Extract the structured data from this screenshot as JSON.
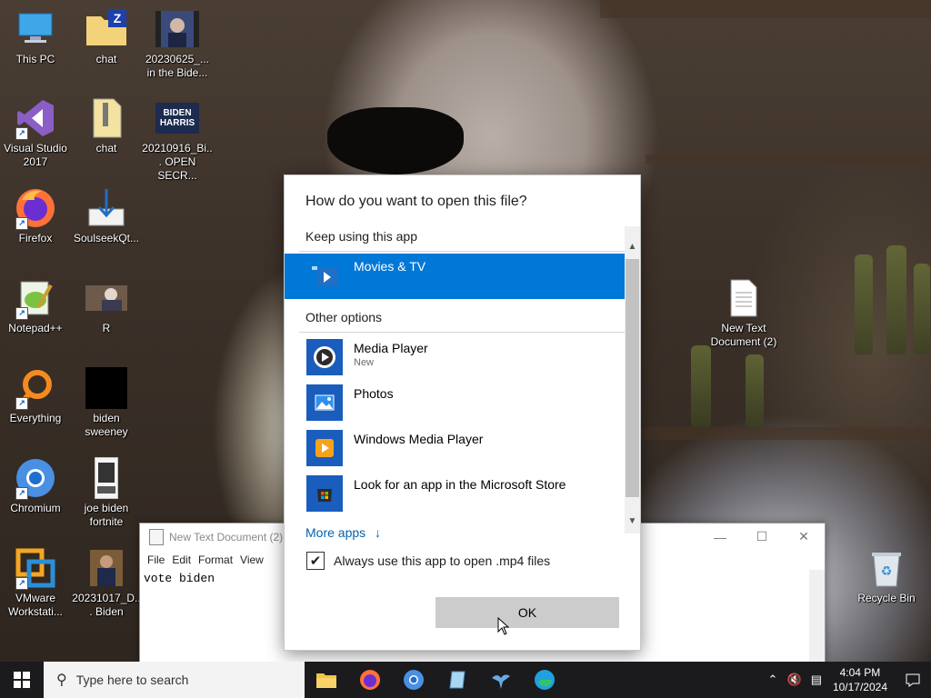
{
  "desktop": {
    "icons": [
      {
        "label": "This PC"
      },
      {
        "label": "chat"
      },
      {
        "label": "20230625_... in the Bide..."
      },
      {
        "label": "Visual Studio 2017"
      },
      {
        "label": "chat"
      },
      {
        "label": "20210916_Bi... OPEN SECR..."
      },
      {
        "label": "Firefox"
      },
      {
        "label": "SoulseekQt..."
      },
      {
        "label": "Notepad++"
      },
      {
        "label": "R"
      },
      {
        "label": "Everything"
      },
      {
        "label": "biden sweeney"
      },
      {
        "label": "Chromium"
      },
      {
        "label": "joe biden fortnite"
      },
      {
        "label": "VMware Workstati..."
      },
      {
        "label": "20231017_D... Biden"
      },
      {
        "label": "New Text Document (2)"
      },
      {
        "label": "Recycle Bin"
      }
    ],
    "thumb_text": {
      "biden_harris_line1": "BIDEN",
      "biden_harris_line2": "HARRIS"
    }
  },
  "notepad": {
    "title": "New Text Document (2) -",
    "menu": [
      "File",
      "Edit",
      "Format",
      "View"
    ],
    "content": "vote biden"
  },
  "dialog": {
    "title": "How do you want to open this file?",
    "keep_using_header": "Keep using this app",
    "current_app": {
      "name": "Movies & TV"
    },
    "other_header": "Other options",
    "apps": [
      {
        "name": "Media Player",
        "sub": "New"
      },
      {
        "name": "Photos"
      },
      {
        "name": "Windows Media Player"
      },
      {
        "name": "Look for an app in the Microsoft Store"
      }
    ],
    "more_apps": "More apps",
    "more_apps_arrow": "↓",
    "always_use": "Always use this app to open .mp4 files",
    "always_checked": true,
    "ok": "OK"
  },
  "taskbar": {
    "search_placeholder": "Type here to search",
    "time": "4:04 PM",
    "date": "10/17/2024"
  },
  "colors": {
    "accent": "#0078d7",
    "taskbar": "#1b1b1d",
    "link": "#0063b1"
  }
}
